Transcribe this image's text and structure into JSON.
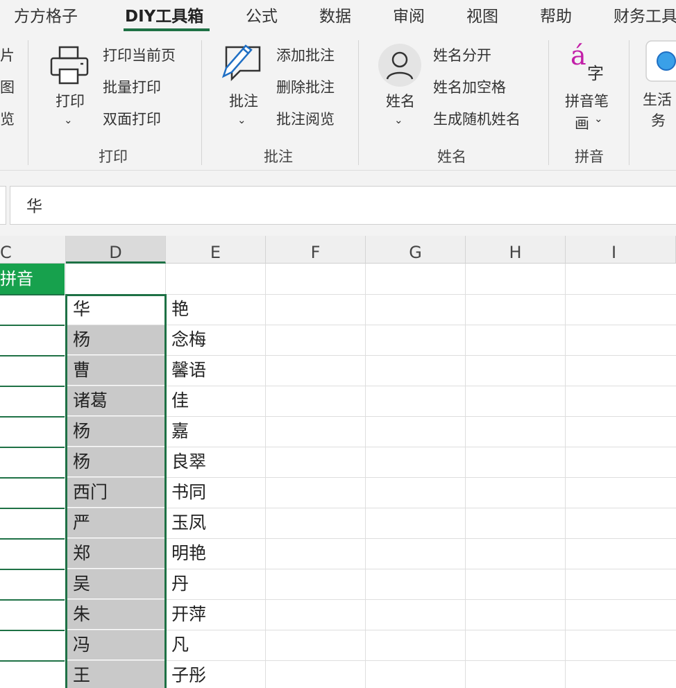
{
  "tabs": [
    "方方格子",
    "DIY工具箱",
    "公式",
    "数据",
    "审阅",
    "视图",
    "帮助",
    "财务工具"
  ],
  "active_tab": "DIY工具箱",
  "ribbon": {
    "left_partial": [
      "片",
      "图",
      "览"
    ],
    "print_group": {
      "main_label": "打印",
      "items": [
        "打印当前页",
        "批量打印",
        "双面打印"
      ],
      "group_label": "打印"
    },
    "comment_group": {
      "main_label": "批注",
      "items": [
        "添加批注",
        "删除批注",
        "批注阅览"
      ],
      "group_label": "批注"
    },
    "name_group": {
      "main_label": "姓名",
      "items": [
        "姓名分开",
        "姓名加空格",
        "生成随机姓名"
      ],
      "group_label": "姓名"
    },
    "pinyin_group": {
      "icon_a": "á",
      "icon_zi": "字",
      "main_label_1": "拼音笔",
      "main_label_2": "画",
      "group_label": "拼音"
    },
    "life_group": {
      "main_label_1": "生活",
      "main_label_2": "务"
    },
    "caret": "⌄"
  },
  "formula_bar": {
    "value": "华"
  },
  "sheet": {
    "columns": [
      "C",
      "D",
      "E",
      "F",
      "G",
      "H",
      "I"
    ],
    "selected_column": "D",
    "header_c": "拼音",
    "d_values": [
      "华",
      "杨",
      "曹",
      "诸葛",
      "杨",
      "杨",
      "西门",
      "严",
      "郑",
      "吴",
      "朱",
      "冯",
      "王"
    ],
    "e_values": [
      "艳",
      "念梅",
      "馨语",
      "佳",
      "嘉",
      "良翠",
      "书同",
      "玉凤",
      "明艳",
      "丹",
      "开萍",
      "凡",
      "子彤"
    ]
  },
  "colors": {
    "accent_green": "#1e7145",
    "header_green": "#17a14d",
    "selection_gray": "#c9c9c9"
  }
}
